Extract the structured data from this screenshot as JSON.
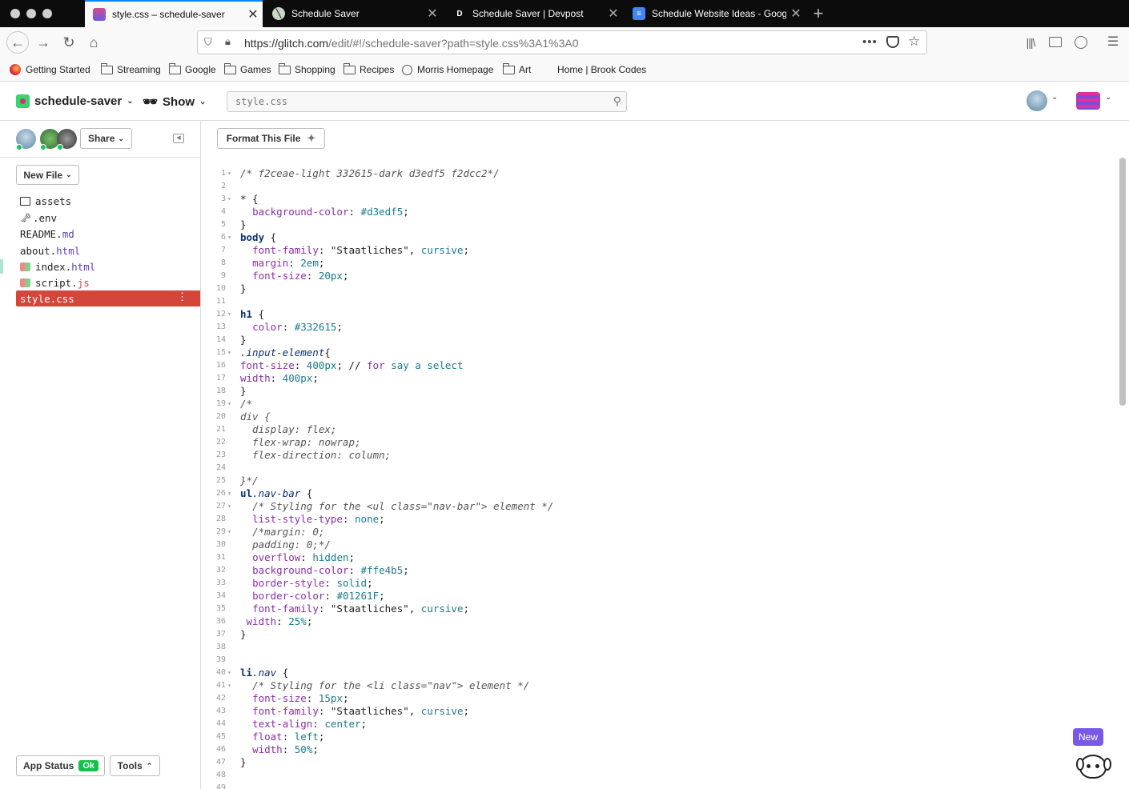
{
  "browser": {
    "tabs": [
      {
        "title": "style.css – schedule-saver",
        "active": true
      },
      {
        "title": "Schedule Saver",
        "active": false
      },
      {
        "title": "Schedule Saver | Devpost",
        "active": false
      },
      {
        "title": "Schedule Website Ideas - Goog",
        "active": false
      }
    ],
    "url_main": "https://glitch.com",
    "url_rest": "/edit/#!/schedule-saver?path=style.css%3A1%3A0",
    "bookmarks": [
      "Getting Started",
      "Streaming",
      "Google",
      "Games",
      "Shopping",
      "Recipes",
      "Morris Homepage",
      "Art",
      "Home | Brook Codes"
    ]
  },
  "header": {
    "project_name": "schedule-saver",
    "show_label": "Show",
    "search_placeholder": "style.css"
  },
  "sidebar": {
    "share_label": "Share",
    "new_file_label": "New File",
    "files": [
      {
        "name": "assets",
        "ext": ""
      },
      {
        "name": ".env",
        "ext": ""
      },
      {
        "name": "README.",
        "ext": "md"
      },
      {
        "name": "about.",
        "ext": "html"
      },
      {
        "name": "index.",
        "ext": "html"
      },
      {
        "name": "script.",
        "ext": "js"
      },
      {
        "name": "style.css",
        "ext": ""
      }
    ],
    "app_status_label": "App Status",
    "app_status_badge": "Ok",
    "tools_label": "Tools"
  },
  "editor": {
    "format_label": "Format This File",
    "new_badge": "New",
    "lines": [
      {
        "n": "1",
        "fold": true,
        "segs": [
          [
            "c",
            "/* f2ceae-light 332615-dark d3edf5 f2dcc2*/"
          ]
        ]
      },
      {
        "n": "2",
        "fold": false,
        "segs": []
      },
      {
        "n": "3",
        "fold": true,
        "segs": [
          [
            "t",
            "* {"
          ]
        ]
      },
      {
        "n": "4",
        "fold": false,
        "segs": [
          [
            "t",
            "  "
          ],
          [
            "p",
            "background-color"
          ],
          [
            "t",
            ": "
          ],
          [
            "v",
            "#d3edf5"
          ],
          [
            "t",
            ";"
          ]
        ]
      },
      {
        "n": "5",
        "fold": false,
        "segs": [
          [
            "t",
            "}"
          ]
        ]
      },
      {
        "n": "6",
        "fold": true,
        "segs": [
          [
            "s",
            "body"
          ],
          [
            "t",
            " {"
          ]
        ]
      },
      {
        "n": "7",
        "fold": false,
        "segs": [
          [
            "t",
            "  "
          ],
          [
            "p",
            "font-family"
          ],
          [
            "t",
            ": \"Staatliches\", "
          ],
          [
            "v",
            "cursive"
          ],
          [
            "t",
            ";"
          ]
        ]
      },
      {
        "n": "8",
        "fold": false,
        "segs": [
          [
            "t",
            "  "
          ],
          [
            "p",
            "margin"
          ],
          [
            "t",
            ": "
          ],
          [
            "v",
            "2em"
          ],
          [
            "t",
            ";"
          ]
        ]
      },
      {
        "n": "9",
        "fold": false,
        "segs": [
          [
            "t",
            "  "
          ],
          [
            "p",
            "font-size"
          ],
          [
            "t",
            ": "
          ],
          [
            "v",
            "20px"
          ],
          [
            "t",
            ";"
          ]
        ]
      },
      {
        "n": "10",
        "fold": false,
        "segs": [
          [
            "t",
            "}"
          ]
        ]
      },
      {
        "n": "11",
        "fold": false,
        "segs": []
      },
      {
        "n": "12",
        "fold": true,
        "segs": [
          [
            "s",
            "h1"
          ],
          [
            "t",
            " {"
          ]
        ]
      },
      {
        "n": "13",
        "fold": false,
        "segs": [
          [
            "t",
            "  "
          ],
          [
            "p",
            "color"
          ],
          [
            "t",
            ": "
          ],
          [
            "v",
            "#332615"
          ],
          [
            "t",
            ";"
          ]
        ]
      },
      {
        "n": "14",
        "fold": false,
        "segs": [
          [
            "t",
            "}"
          ]
        ]
      },
      {
        "n": "15",
        "fold": true,
        "segs": [
          [
            "sc",
            ".input-element"
          ],
          [
            "t",
            "{"
          ]
        ]
      },
      {
        "n": "16",
        "fold": false,
        "segs": [
          [
            "p",
            "font-size"
          ],
          [
            "t",
            ": "
          ],
          [
            "v",
            "400px"
          ],
          [
            "t",
            "; // "
          ],
          [
            "p",
            "for"
          ],
          [
            "t",
            " "
          ],
          [
            "v",
            "say"
          ],
          [
            "t",
            " "
          ],
          [
            "v",
            "a"
          ],
          [
            "t",
            " "
          ],
          [
            "v",
            "select"
          ]
        ]
      },
      {
        "n": "17",
        "fold": false,
        "segs": [
          [
            "p",
            "width"
          ],
          [
            "t",
            ": "
          ],
          [
            "v",
            "400px"
          ],
          [
            "t",
            ";"
          ]
        ]
      },
      {
        "n": "18",
        "fold": false,
        "segs": [
          [
            "t",
            "}"
          ]
        ]
      },
      {
        "n": "19",
        "fold": true,
        "segs": [
          [
            "c",
            "/*"
          ]
        ]
      },
      {
        "n": "20",
        "fold": false,
        "segs": [
          [
            "c",
            "div {"
          ]
        ]
      },
      {
        "n": "21",
        "fold": false,
        "segs": [
          [
            "c",
            "  display: flex;"
          ]
        ]
      },
      {
        "n": "22",
        "fold": false,
        "segs": [
          [
            "c",
            "  flex-wrap: nowrap;"
          ]
        ]
      },
      {
        "n": "23",
        "fold": false,
        "segs": [
          [
            "c",
            "  flex-direction: column;"
          ]
        ]
      },
      {
        "n": "24",
        "fold": false,
        "segs": []
      },
      {
        "n": "25",
        "fold": false,
        "segs": [
          [
            "c",
            "}*/"
          ]
        ]
      },
      {
        "n": "26",
        "fold": true,
        "segs": [
          [
            "s",
            "ul"
          ],
          [
            "sc",
            ".nav-bar"
          ],
          [
            "t",
            " {"
          ]
        ]
      },
      {
        "n": "27",
        "fold": true,
        "segs": [
          [
            "t",
            "  "
          ],
          [
            "c",
            "/* Styling for the <ul class=\"nav-bar\"> element */"
          ]
        ]
      },
      {
        "n": "28",
        "fold": false,
        "segs": [
          [
            "t",
            "  "
          ],
          [
            "p",
            "list-style-type"
          ],
          [
            "t",
            ": "
          ],
          [
            "v",
            "none"
          ],
          [
            "t",
            ";"
          ]
        ]
      },
      {
        "n": "29",
        "fold": true,
        "segs": [
          [
            "t",
            "  "
          ],
          [
            "c",
            "/*margin: 0;"
          ]
        ]
      },
      {
        "n": "30",
        "fold": false,
        "segs": [
          [
            "t",
            "  "
          ],
          [
            "c",
            "padding: 0;*/"
          ]
        ]
      },
      {
        "n": "31",
        "fold": false,
        "segs": [
          [
            "t",
            "  "
          ],
          [
            "p",
            "overflow"
          ],
          [
            "t",
            ": "
          ],
          [
            "v",
            "hidden"
          ],
          [
            "t",
            ";"
          ]
        ]
      },
      {
        "n": "32",
        "fold": false,
        "segs": [
          [
            "t",
            "  "
          ],
          [
            "p",
            "background-color"
          ],
          [
            "t",
            ": "
          ],
          [
            "v",
            "#ffe4b5"
          ],
          [
            "t",
            ";"
          ]
        ]
      },
      {
        "n": "33",
        "fold": false,
        "segs": [
          [
            "t",
            "  "
          ],
          [
            "p",
            "border-style"
          ],
          [
            "t",
            ": "
          ],
          [
            "v",
            "solid"
          ],
          [
            "t",
            ";"
          ]
        ]
      },
      {
        "n": "34",
        "fold": false,
        "segs": [
          [
            "t",
            "  "
          ],
          [
            "p",
            "border-color"
          ],
          [
            "t",
            ": "
          ],
          [
            "v",
            "#01261F"
          ],
          [
            "t",
            ";"
          ]
        ]
      },
      {
        "n": "35",
        "fold": false,
        "segs": [
          [
            "t",
            "  "
          ],
          [
            "p",
            "font-family"
          ],
          [
            "t",
            ": \"Staatliches\", "
          ],
          [
            "v",
            "cursive"
          ],
          [
            "t",
            ";"
          ]
        ]
      },
      {
        "n": "36",
        "fold": false,
        "segs": [
          [
            "t",
            " "
          ],
          [
            "p",
            "width"
          ],
          [
            "t",
            ": "
          ],
          [
            "v",
            "25%"
          ],
          [
            "t",
            ";"
          ]
        ]
      },
      {
        "n": "37",
        "fold": false,
        "segs": [
          [
            "t",
            "}"
          ]
        ]
      },
      {
        "n": "38",
        "fold": false,
        "segs": []
      },
      {
        "n": "39",
        "fold": false,
        "segs": []
      },
      {
        "n": "40",
        "fold": true,
        "segs": [
          [
            "s",
            "li"
          ],
          [
            "sc",
            ".nav"
          ],
          [
            "t",
            " {"
          ]
        ]
      },
      {
        "n": "41",
        "fold": true,
        "segs": [
          [
            "t",
            "  "
          ],
          [
            "c",
            "/* Styling for the <li class=\"nav\"> element */"
          ]
        ]
      },
      {
        "n": "42",
        "fold": false,
        "segs": [
          [
            "t",
            "  "
          ],
          [
            "p",
            "font-size"
          ],
          [
            "t",
            ": "
          ],
          [
            "v",
            "15px"
          ],
          [
            "t",
            ";"
          ]
        ]
      },
      {
        "n": "43",
        "fold": false,
        "segs": [
          [
            "t",
            "  "
          ],
          [
            "p",
            "font-family"
          ],
          [
            "t",
            ": \"Staatliches\", "
          ],
          [
            "v",
            "cursive"
          ],
          [
            "t",
            ";"
          ]
        ]
      },
      {
        "n": "44",
        "fold": false,
        "segs": [
          [
            "t",
            "  "
          ],
          [
            "p",
            "text-align"
          ],
          [
            "t",
            ": "
          ],
          [
            "v",
            "center"
          ],
          [
            "t",
            ";"
          ]
        ]
      },
      {
        "n": "45",
        "fold": false,
        "segs": [
          [
            "t",
            "  "
          ],
          [
            "p",
            "float"
          ],
          [
            "t",
            ": "
          ],
          [
            "v",
            "left"
          ],
          [
            "t",
            ";"
          ]
        ]
      },
      {
        "n": "46",
        "fold": false,
        "segs": [
          [
            "t",
            "  "
          ],
          [
            "p",
            "width"
          ],
          [
            "t",
            ": "
          ],
          [
            "v",
            "50%"
          ],
          [
            "t",
            ";"
          ]
        ]
      },
      {
        "n": "47",
        "fold": false,
        "segs": [
          [
            "t",
            "}"
          ]
        ]
      },
      {
        "n": "48",
        "fold": false,
        "segs": []
      },
      {
        "n": "49",
        "fold": false,
        "segs": []
      }
    ]
  }
}
